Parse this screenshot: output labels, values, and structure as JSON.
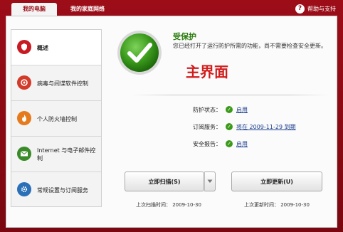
{
  "tabs": [
    {
      "label": "我的电脑"
    },
    {
      "label": "我的家庭网络"
    }
  ],
  "help": {
    "label": "帮助与支持",
    "icon": "question-icon"
  },
  "sidebar": {
    "items": [
      {
        "label": "概述",
        "icon": "shield-icon"
      },
      {
        "label": "病毒与间谍软件控制",
        "icon": "virus-scan-icon"
      },
      {
        "label": "个人防火墙控制",
        "icon": "firewall-icon"
      },
      {
        "label": "Internet 与电子邮件控制",
        "icon": "email-icon"
      },
      {
        "label": "常规设置与订阅服务",
        "icon": "gear-icon"
      }
    ]
  },
  "status": {
    "title": "受保护",
    "description": "您已经打开了运行防护所需的功能，尚不需要检查安全更新。",
    "overlay_label": "主界面"
  },
  "info": {
    "rows": [
      {
        "label": "防护状态：",
        "value": "启用"
      },
      {
        "label": "订阅服务：",
        "value": "将在 2009-11-29 到期"
      },
      {
        "label": "安全报告：",
        "value": "启用"
      }
    ]
  },
  "actions": {
    "scan_label": "立即扫描(S)",
    "update_label": "立即更新(U)",
    "last_scan": "上次扫描时间：  2009-10-30",
    "last_update": "上次更新时间：  2009-10-30"
  },
  "colors": {
    "brand_red": "#9c0d18",
    "status_green": "#3c9a1a",
    "overlay_red": "#d21d1d"
  }
}
